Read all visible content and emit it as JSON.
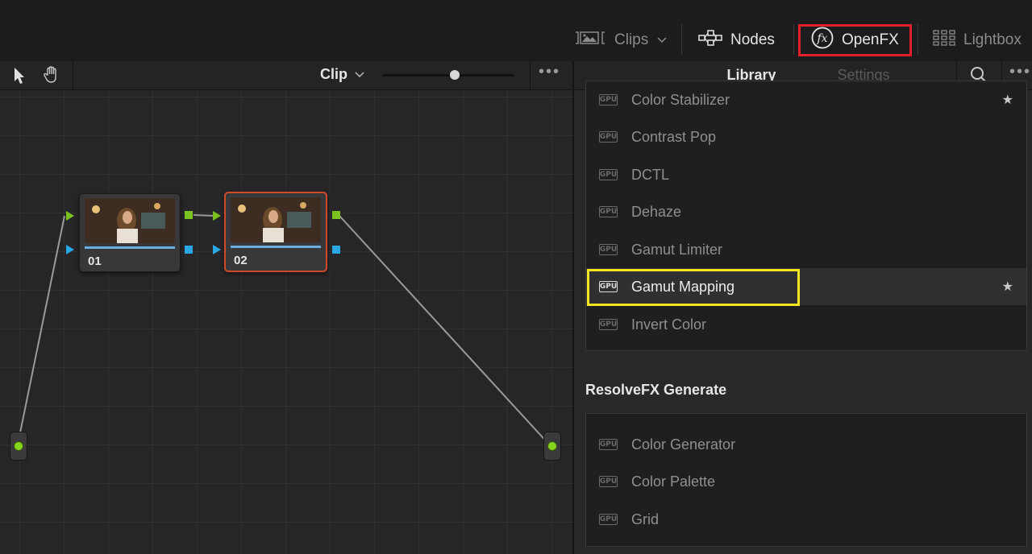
{
  "topbar": {
    "clips_label": "Clips",
    "nodes_label": "Nodes",
    "openfx_label": "OpenFX",
    "lightbox_label": "Lightbox"
  },
  "node_editor": {
    "mode_label": "Clip",
    "zoom_level": 0.55,
    "nodes": [
      {
        "number": "01"
      },
      {
        "number": "02"
      }
    ]
  },
  "panel": {
    "tabs": [
      {
        "label": "Library",
        "active": true
      },
      {
        "label": "Settings",
        "active": false
      }
    ],
    "resolvefx_list": [
      {
        "label": "Color Stabilizer",
        "starred": true,
        "badge": "GPU"
      },
      {
        "label": "Contrast Pop",
        "starred": false,
        "badge": "GPU"
      },
      {
        "label": "DCTL",
        "starred": false,
        "badge": "GPU"
      },
      {
        "label": "Dehaze",
        "starred": false,
        "badge": "GPU"
      },
      {
        "label": "Gamut Limiter",
        "starred": false,
        "badge": "GPU"
      },
      {
        "label": "Gamut Mapping",
        "starred": true,
        "badge": "GPU",
        "selected": true
      },
      {
        "label": "Invert Color",
        "starred": false,
        "badge": "GPU"
      }
    ],
    "generate_title": "ResolveFX Generate",
    "generate_list": [
      {
        "label": "Color Generator",
        "badge": "GPU"
      },
      {
        "label": "Color Palette",
        "badge": "GPU"
      },
      {
        "label": "Grid",
        "badge": "GPU"
      }
    ],
    "star_glyph": "★"
  },
  "colors": {
    "accent_red": "#e0202a",
    "highlight_yellow": "#f2e61e",
    "port_green": "#7cc21e",
    "port_blue": "#2aa8e6"
  }
}
